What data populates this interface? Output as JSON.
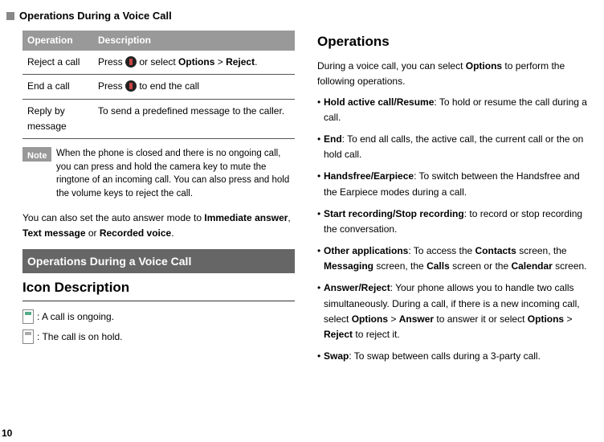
{
  "top_heading": "Operations During a Voice Call",
  "table": {
    "headers": [
      "Operation",
      "Description"
    ],
    "rows": [
      {
        "op": "Reject a call",
        "desc_pre": "Press ",
        "desc_mid": " or select ",
        "opt": "Options",
        "gt": " > ",
        "rej": "Reject",
        "tail": ".",
        "has_icon": true
      },
      {
        "op": "End a call",
        "desc_pre": "Press ",
        "desc_mid": " to end the call",
        "has_icon": true
      },
      {
        "op": "Reply by message",
        "desc_full": "To send a predefined message to the caller."
      }
    ]
  },
  "note_label": "Note",
  "note_text": "When the phone is closed and there is no ongoing call, you can press and hold the camera key to mute the ringtone of an incoming call. You can also press and hold the volume keys to reject the call.",
  "auto_answer_pre": "You can also set the auto answer mode to ",
  "auto_answer_b1": "Immediate answer",
  "auto_answer_mid1": ", ",
  "auto_answer_b2": "Text message",
  "auto_answer_mid2": " or ",
  "auto_answer_b3": "Recorded voice",
  "auto_answer_tail": ".",
  "section_bar": " Operations During a Voice Call",
  "icon_desc_heading": "Icon Description",
  "icon_ongoing": ": A call is ongoing.",
  "icon_hold": ": The call is on hold.",
  "operations_heading": "Operations",
  "ops_intro_pre": "During a voice call, you can select ",
  "ops_intro_b": "Options",
  "ops_intro_post": " to perform the following operations.",
  "bullets": [
    {
      "b": "Hold active call/Resume",
      "rest": ": To hold or resume the call during a call."
    },
    {
      "b": "End",
      "rest": ": To end all calls,  the active call,  the current call or the on hold call."
    },
    {
      "b": "Handsfree/Earpiece",
      "rest": ": To switch between the Handsfree and the Earpiece modes during a call."
    },
    {
      "b": "Start recording/Stop recording",
      "rest": ": to record or stop recording the conversation."
    },
    {
      "pre": "",
      "b": "Other applications",
      "rest_parts": [
        ": To access the ",
        "Contacts",
        " screen, the ",
        "Messaging",
        " screen, the ",
        "Calls",
        " screen or the ",
        "Calendar",
        " screen."
      ],
      "multi": true
    },
    {
      "pre": "",
      "b": "Answer/Reject",
      "rest_parts": [
        ": Your phone allows you to handle two calls simultaneously. During a call, if there is a new incoming call, select ",
        "Options",
        " > ",
        "Answer",
        " to answer it or select ",
        "Options",
        " > ",
        "Reject",
        " to reject it."
      ],
      "multi": true
    },
    {
      "b": "Swap",
      "rest": ": To swap between calls during a 3-party call."
    }
  ],
  "page_number": "10"
}
